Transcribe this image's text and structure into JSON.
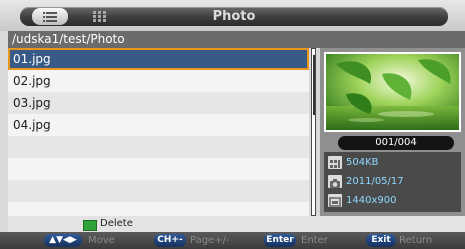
{
  "title": "Photo",
  "path": "/udska1/test/Photo",
  "files": [
    {
      "name": "01.jpg",
      "selected": true
    },
    {
      "name": "02.jpg",
      "selected": false
    },
    {
      "name": "03.jpg",
      "selected": false
    },
    {
      "name": "04.jpg",
      "selected": false
    },
    {
      "name": "",
      "selected": false
    },
    {
      "name": "",
      "selected": false
    },
    {
      "name": "",
      "selected": false
    },
    {
      "name": "",
      "selected": false
    }
  ],
  "preview": {
    "counter": "001/004",
    "size": "504KB",
    "date": "2011/05/17",
    "resolution": "1440x900"
  },
  "legend": {
    "label": "Delete",
    "color": "#2fa33a"
  },
  "help": [
    {
      "key": "▲▼◀▶",
      "label": "Move"
    },
    {
      "key": "CH+-",
      "label": "Page+/-"
    },
    {
      "key": "Enter",
      "label": "Enter"
    },
    {
      "key": "Exit",
      "label": "Return"
    }
  ],
  "colors": {
    "selection": "#375a87",
    "selection_border": "#e9951e",
    "info_text": "#8ed8ff"
  }
}
